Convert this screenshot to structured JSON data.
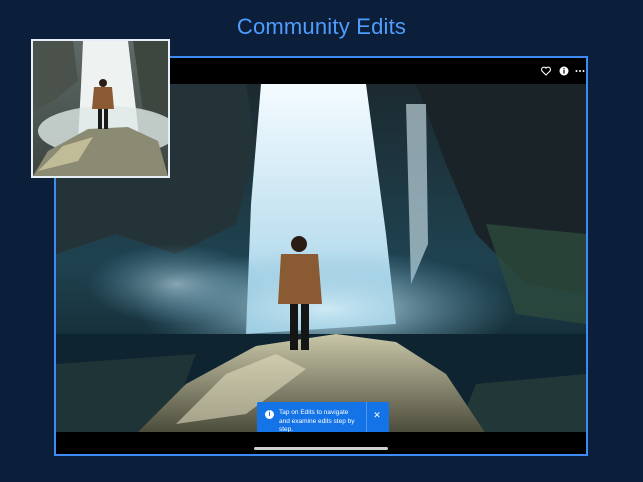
{
  "page_title": "Community Edits",
  "toolbar": {
    "icons": [
      "heart-icon",
      "info-icon",
      "more-icon"
    ]
  },
  "toast": {
    "message": "Tap on Edits to navigate and examine edits step by step.",
    "close_glyph": "✕",
    "info_glyph": "i"
  },
  "colors": {
    "background": "#0b1e3a",
    "accent": "#3b8cf5",
    "title": "#4f9dff",
    "toast": "#1473e6"
  }
}
